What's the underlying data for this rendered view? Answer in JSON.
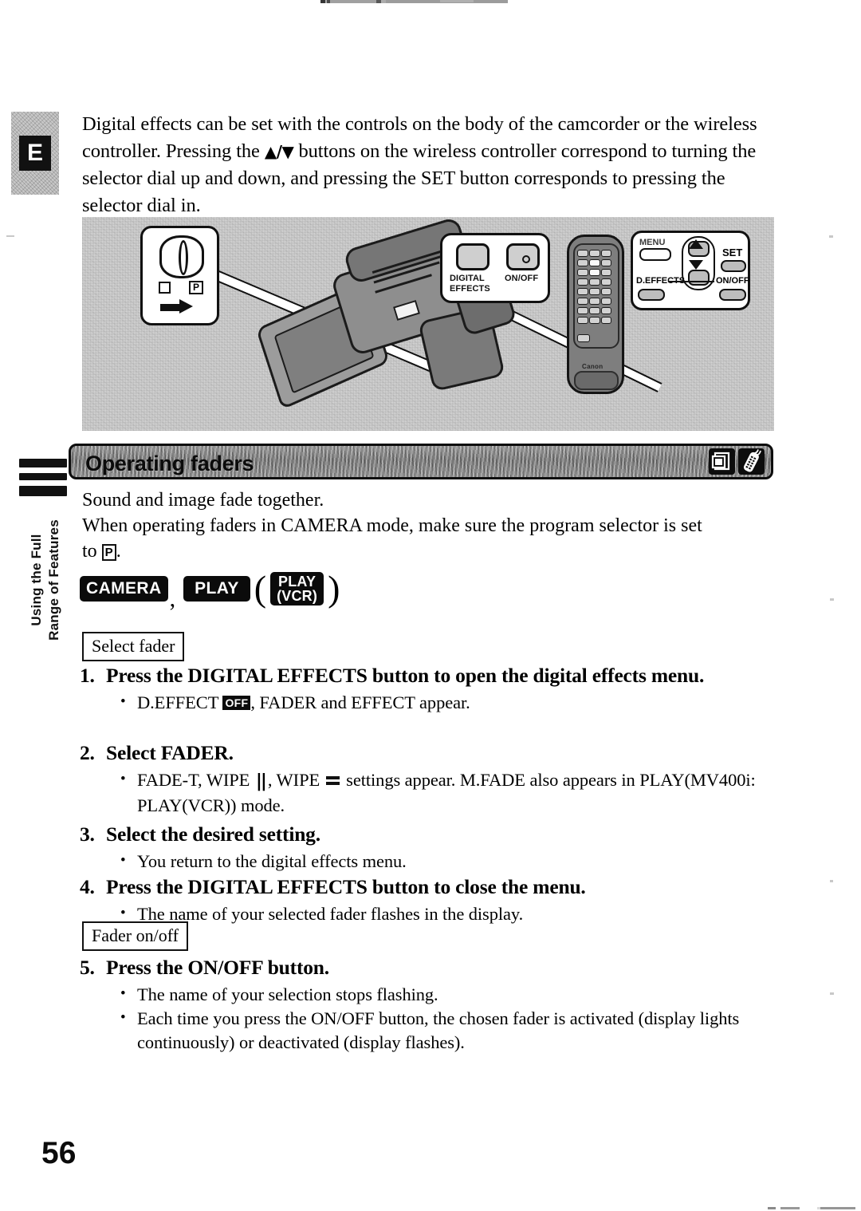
{
  "page": {
    "number": "56",
    "language_badge": "E"
  },
  "side_tab": {
    "label": "Using the Full\nRange of Features"
  },
  "intro": {
    "line1": "Digital effects can be set with the controls on the body of the camcorder or the",
    "line2_a": "wireless controller. Pressing the ",
    "arrows": "▲/▼",
    "line2_b": " buttons on the wireless controller",
    "line3": "correspond to turning the selector dial up and down, and pressing the SET button",
    "line4": "corresponds to pressing the selector dial in."
  },
  "illustration": {
    "program_selector_callout": {
      "name": "program-selector-dial",
      "square_mark": "",
      "p_mark": "P"
    },
    "camera_buttons_callout": {
      "digital_effects_label": "DIGITAL\nEFFECTS",
      "onoff_label": "ON/OFF"
    },
    "remote_callout": {
      "menu_label": "MENU",
      "set_label": "SET",
      "d_effects_label": "D.EFFECTS",
      "onoff_label": "ON/OFF",
      "up_arrow": "▲",
      "down_arrow": "▼"
    },
    "remote_brand": "Canon"
  },
  "banner": {
    "title": "Operating faders",
    "icons": [
      "card-screen-icon",
      "wireless-remote-icon"
    ]
  },
  "lead": {
    "line1": "Sound and image fade together.",
    "line2": "When operating faders in CAMERA mode, make sure the program selector is set",
    "line3_a": "to ",
    "line3_badge": "P",
    "line3_b": "."
  },
  "modes": {
    "camera": "CAMERA",
    "comma": ",",
    "play": "PLAY",
    "open_paren": "(",
    "play_vcr_top": "PLAY",
    "play_vcr_bottom": "(VCR)",
    "close_paren": ")"
  },
  "boxes": {
    "select_fader": "Select fader",
    "fader_onoff": "Fader on/off"
  },
  "steps": [
    {
      "num": "1.",
      "text": "Press the DIGITAL EFFECTS button to open the digital effects menu.",
      "bullets_prefix": "D.EFFECT ",
      "bullets_chip": "OFF",
      "bullets_suffix": ", FADER and EFFECT appear."
    },
    {
      "num": "2.",
      "text": "Select FADER.",
      "b_a": "FADE-T, WIPE ",
      "b_b": ", WIPE ",
      "b_c": " settings appear. M.FADE also appears in PLAY(MV400i: PLAY(VCR)) mode."
    },
    {
      "num": "3.",
      "text": "Select the desired setting.",
      "bullet": "You return to the digital effects menu."
    },
    {
      "num": "4.",
      "text": "Press the DIGITAL EFFECTS button to close the menu.",
      "bullet": "The name of your selected fader flashes in the display."
    },
    {
      "num": "5.",
      "text": "Press the ON/OFF button.",
      "bullet1": "The name of your selection stops flashing.",
      "bullet2": "Each time you press the ON/OFF button, the chosen fader is activated (display lights continuously) or deactivated (display flashes)."
    }
  ],
  "colors": {
    "ink": "#0b0b0b",
    "banner_fill": "#7a7a7a",
    "illustration_fill": "#dcdcdc",
    "badge_fill": "#0b0b0b"
  }
}
